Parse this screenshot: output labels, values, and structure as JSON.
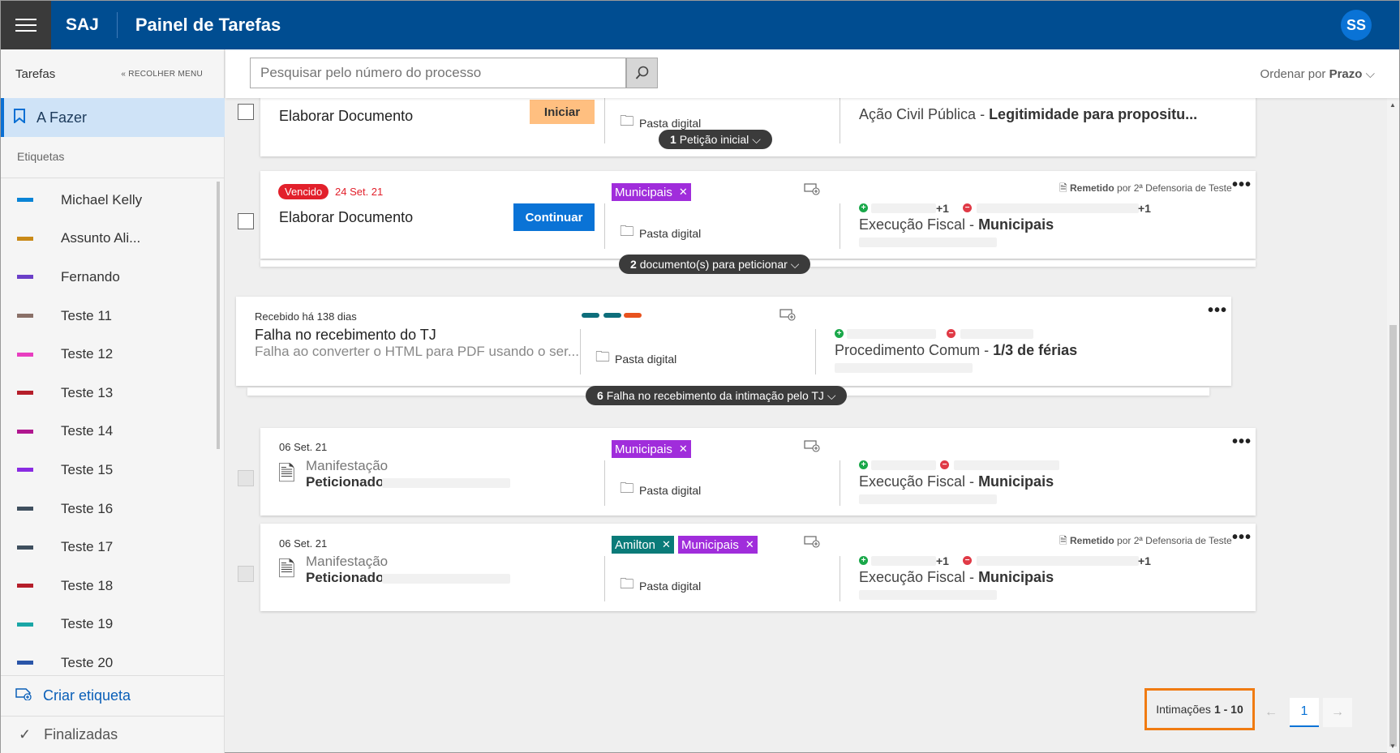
{
  "header": {
    "brand": "SAJ",
    "title": "Painel de Tarefas",
    "avatar": "SS"
  },
  "sidebar": {
    "title": "Tarefas",
    "collapse": "RECOLHER MENU",
    "active": "A Fazer",
    "etiquetas_title": "Etiquetas",
    "labels": [
      {
        "name": "Michael Kelly",
        "color": "#0a84d6"
      },
      {
        "name": "Assunto Ali...",
        "color": "#c98a18"
      },
      {
        "name": "Fernando",
        "color": "#6b3fc8"
      },
      {
        "name": "Teste 11",
        "color": "#8a7068"
      },
      {
        "name": "Teste 12",
        "color": "#e83ec0"
      },
      {
        "name": "Teste 13",
        "color": "#b51e2a"
      },
      {
        "name": "Teste 14",
        "color": "#b0168f"
      },
      {
        "name": "Teste 15",
        "color": "#8a2be2"
      },
      {
        "name": "Teste 16",
        "color": "#3f4f5e"
      },
      {
        "name": "Teste 17",
        "color": "#3f4f5e"
      },
      {
        "name": "Teste 18",
        "color": "#b51e2a"
      },
      {
        "name": "Teste 19",
        "color": "#1aa6a6"
      },
      {
        "name": "Teste 20",
        "color": "#2a55a8"
      }
    ],
    "create": "Criar etiqueta",
    "finished": "Finalizadas"
  },
  "toolbar": {
    "search_placeholder": "Pesquisar pelo número do processo",
    "order_label": "Ordenar por",
    "order_value": "Prazo"
  },
  "cards": {
    "c1": {
      "title": "Elaborar Documento",
      "button": "Iniciar",
      "pasta": "Pasta digital",
      "proc_a": "Ação Civil Pública - ",
      "proc_b": "Legitimidade para propositu...",
      "pill_n": "1",
      "pill": "Petição inicial"
    },
    "c2": {
      "badge": "Vencido",
      "date": "24 Set. 21",
      "tag": "Municipais",
      "title": "Elaborar Documento",
      "button": "Continuar",
      "pasta": "Pasta digital",
      "remetido": "Remetido",
      "remetido_by": "por 2ª Defensoria de Teste",
      "plus1": "+1",
      "plus2": "+1",
      "proc_a": "Execução Fiscal - ",
      "proc_b": "Municipais",
      "pill_n": "2",
      "pill": "documento(s) para peticionar"
    },
    "c3": {
      "received": "Recebido há 138 dias",
      "title": "Falha no recebimento do TJ",
      "desc": "Falha ao converter o HTML para PDF usando o ser...",
      "pasta": "Pasta digital",
      "proc_a": "Procedimento Comum - ",
      "proc_b": "1/3 de férias",
      "pill_n": "6",
      "pill": "Falha no recebimento da intimação pelo TJ",
      "dashes": [
        "#0e6e7b",
        "#0e6e7b",
        "#e8521e"
      ]
    },
    "c4": {
      "date": "06 Set. 21",
      "tag": "Municipais",
      "sub1": "Manifestação",
      "sub2": "Peticionado",
      "pasta": "Pasta digital",
      "proc_a": "Execução Fiscal - ",
      "proc_b": "Municipais"
    },
    "c5": {
      "date": "06 Set. 21",
      "tag1": "Amilton",
      "tag2": "Municipais",
      "sub1": "Manifestação",
      "sub2": "Peticionado",
      "pasta": "Pasta digital",
      "remetido": "Remetido",
      "remetido_by": "por 2ª Defensoria de Teste",
      "plus1": "+1",
      "plus2": "+1",
      "proc_a": "Execução Fiscal - ",
      "proc_b": "Municipais"
    }
  },
  "pagination": {
    "label": "Intimações",
    "range": "1 - 10",
    "page": "1"
  }
}
